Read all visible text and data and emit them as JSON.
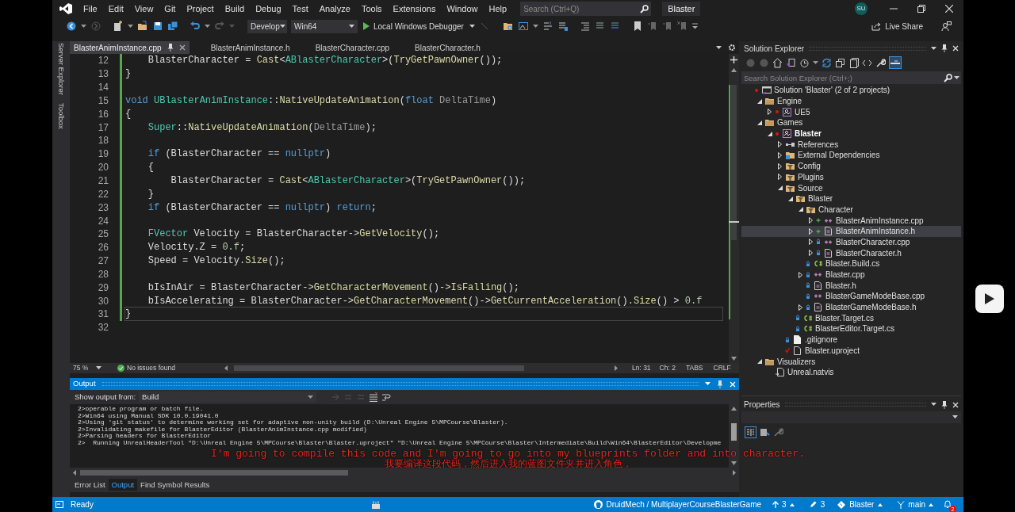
{
  "menu": [
    "File",
    "Edit",
    "View",
    "Git",
    "Project",
    "Build",
    "Debug",
    "Test",
    "Analyze",
    "Tools",
    "Extensions",
    "Window",
    "Help"
  ],
  "search": {
    "placeholder": "Search (Ctrl+Q)"
  },
  "window": {
    "title": "Blaster",
    "user_initials": "SU"
  },
  "toolbar": {
    "configuration": "Develop",
    "platform": "Win64",
    "run_target": "Local Windows Debugger",
    "live_share": "Live Share"
  },
  "side_strip": [
    "Server Explorer",
    "Toolbox"
  ],
  "tabs": [
    {
      "label": "BlasterAnimInstance.cpp",
      "selected": true
    },
    {
      "label": "BlasterAnimInstance.h",
      "selected": false
    },
    {
      "label": "BlasterCharacter.cpp",
      "selected": false
    },
    {
      "label": "BlasterCharacter.h",
      "selected": false
    }
  ],
  "code": [
    {
      "number": "12",
      "current": false,
      "changed": true,
      "tokens": [
        {
          "text": "    BlasterCharacter = ",
          "kind": "plain"
        },
        {
          "text": "Cast",
          "kind": "fn"
        },
        {
          "text": "<",
          "kind": "plain"
        },
        {
          "text": "ABlasterCharacter",
          "kind": "type"
        },
        {
          "text": ">(",
          "kind": "plain"
        },
        {
          "text": "TryGetPawnOwner",
          "kind": "fn"
        },
        {
          "text": "());",
          "kind": "plain"
        }
      ]
    },
    {
      "number": "13",
      "current": false,
      "changed": true,
      "tokens": [
        {
          "text": "}",
          "kind": "plain"
        }
      ]
    },
    {
      "number": "14",
      "current": false,
      "changed": true
    },
    {
      "number": "15",
      "current": false,
      "changed": true,
      "tokens": [
        {
          "text": "void ",
          "kind": "kw"
        },
        {
          "text": "UBlasterAnimInstance",
          "kind": "type"
        },
        {
          "text": "::",
          "kind": "plain"
        },
        {
          "text": "NativeUpdateAnimation",
          "kind": "fn"
        },
        {
          "text": "(",
          "kind": "plain"
        },
        {
          "text": "float ",
          "kind": "kw"
        },
        {
          "text": "DeltaTime",
          "kind": "param"
        },
        {
          "text": ")",
          "kind": "plain"
        }
      ]
    },
    {
      "number": "16",
      "current": false,
      "changed": true,
      "tokens": [
        {
          "text": "{",
          "kind": "plain"
        }
      ]
    },
    {
      "number": "17",
      "current": false,
      "changed": true,
      "tokens": [
        {
          "text": "    Super",
          "kind": "type"
        },
        {
          "text": "::",
          "kind": "plain"
        },
        {
          "text": "NativeUpdateAnimation",
          "kind": "fn"
        },
        {
          "text": "(",
          "kind": "plain"
        },
        {
          "text": "DeltaTime",
          "kind": "param"
        },
        {
          "text": ");",
          "kind": "plain"
        }
      ]
    },
    {
      "number": "18",
      "current": false,
      "changed": true
    },
    {
      "number": "19",
      "current": false,
      "changed": true,
      "tokens": [
        {
          "text": "    if",
          "kind": "kw"
        },
        {
          "text": " (BlasterCharacter == ",
          "kind": "plain"
        },
        {
          "text": "nullptr",
          "kind": "kw"
        },
        {
          "text": ")",
          "kind": "plain"
        }
      ]
    },
    {
      "number": "20",
      "current": false,
      "changed": true,
      "tokens": [
        {
          "text": "    {",
          "kind": "plain"
        }
      ]
    },
    {
      "number": "21",
      "current": false,
      "changed": true,
      "tokens": [
        {
          "text": "        BlasterCharacter = ",
          "kind": "plain"
        },
        {
          "text": "Cast",
          "kind": "fn"
        },
        {
          "text": "<",
          "kind": "plain"
        },
        {
          "text": "ABlasterCharacter",
          "kind": "type"
        },
        {
          "text": ">(",
          "kind": "plain"
        },
        {
          "text": "TryGetPawnOwner",
          "kind": "fn"
        },
        {
          "text": "());",
          "kind": "plain"
        }
      ]
    },
    {
      "number": "22",
      "current": false,
      "changed": true,
      "tokens": [
        {
          "text": "    }",
          "kind": "plain"
        }
      ]
    },
    {
      "number": "23",
      "current": false,
      "changed": true,
      "tokens": [
        {
          "text": "    if",
          "kind": "kw"
        },
        {
          "text": " (BlasterCharacter == ",
          "kind": "plain"
        },
        {
          "text": "nullptr",
          "kind": "kw"
        },
        {
          "text": ") ",
          "kind": "plain"
        },
        {
          "text": "return",
          "kind": "kw"
        },
        {
          "text": ";",
          "kind": "plain"
        }
      ]
    },
    {
      "number": "24",
      "current": false,
      "changed": true
    },
    {
      "number": "25",
      "current": false,
      "changed": true,
      "tokens": [
        {
          "text": "    FVector",
          "kind": "type"
        },
        {
          "text": " Velocity = BlasterCharacter->",
          "kind": "plain"
        },
        {
          "text": "GetVelocity",
          "kind": "fn"
        },
        {
          "text": "();",
          "kind": "plain"
        }
      ]
    },
    {
      "number": "26",
      "current": false,
      "changed": true,
      "tokens": [
        {
          "text": "    Velocity.Z = ",
          "kind": "plain"
        },
        {
          "text": "0.f",
          "kind": "num"
        },
        {
          "text": ";",
          "kind": "plain"
        }
      ]
    },
    {
      "number": "27",
      "current": false,
      "changed": true,
      "tokens": [
        {
          "text": "    Speed = Velocity.",
          "kind": "plain"
        },
        {
          "text": "Size",
          "kind": "fn"
        },
        {
          "text": "();",
          "kind": "plain"
        }
      ]
    },
    {
      "number": "28",
      "current": false,
      "changed": true
    },
    {
      "number": "29",
      "current": false,
      "changed": true,
      "tokens": [
        {
          "text": "    bIsInAir = BlasterCharacter->",
          "kind": "plain"
        },
        {
          "text": "GetCharacterMovement",
          "kind": "fn"
        },
        {
          "text": "()->",
          "kind": "plain"
        },
        {
          "text": "IsFalling",
          "kind": "fn"
        },
        {
          "text": "();",
          "kind": "plain"
        }
      ]
    },
    {
      "number": "30",
      "current": false,
      "changed": true,
      "tokens": [
        {
          "text": "    bIsAccelerating = BlasterCharacter->",
          "kind": "plain"
        },
        {
          "text": "GetCharacterMovement",
          "kind": "fn"
        },
        {
          "text": "()->",
          "kind": "plain"
        },
        {
          "text": "GetCurrentAcceleration",
          "kind": "fn"
        },
        {
          "text": "().",
          "kind": "plain"
        },
        {
          "text": "Size",
          "kind": "fn"
        },
        {
          "text": "() > ",
          "kind": "plain"
        },
        {
          "text": "0.f",
          "kind": "num"
        }
      ]
    },
    {
      "number": "31",
      "current": true,
      "changed": true,
      "tokens": [
        {
          "text": "}",
          "kind": "plain"
        }
      ]
    },
    {
      "number": "32",
      "current": false,
      "changed": false
    }
  ],
  "editor_status": {
    "zoom": "75 %",
    "issues": "No issues found",
    "line": "Ln: 31",
    "column": "Ch: 2",
    "indent": "TABS",
    "line_endings": "CRLF"
  },
  "output": {
    "title": "Output",
    "source_label": "Show output from:",
    "source": "Build",
    "lines": [
      "2>operable program or batch file.",
      "2>Win64 using Manual SDK 10.0.19041.0",
      "2>Using 'git status' to determine working set for adaptive non-unity build (D:\\Unreal Engine 5\\MPCourse\\Blaster).",
      "2>Invalidating makefile for BlasterEditor (BlasterAnimInstance.cpp modified)",
      "2>Parsing headers for BlasterEditor",
      "2>  Running UnrealHeaderTool \"D:\\Unreal Engine 5\\MPCourse\\Blaster\\Blaster.uproject\" \"D:\\Unreal Engine 5\\MPCourse\\Blaster\\Intermediate\\Build\\Win64\\BlasterEditor\\Developme"
    ]
  },
  "bottom_tabs": [
    {
      "label": "Error List",
      "selected": false
    },
    {
      "label": "Output",
      "selected": true
    },
    {
      "label": "Find Symbol Results",
      "selected": false
    }
  ],
  "solution_explorer": {
    "title": "Solution Explorer",
    "search_placeholder": "Search Solution Explorer (Ctrl+;)",
    "tree": [
      {
        "label": "Solution 'Blaster' (2 of 2 projects)",
        "kind": "solution",
        "pending_change": true,
        "selected": false,
        "children": [
          {
            "label": "Engine",
            "kind": "folder",
            "expanded": true,
            "selected": false,
            "children": [
              {
                "label": "UE5",
                "kind": "project",
                "pending_change": true,
                "expanded": false,
                "selected": false
              }
            ]
          },
          {
            "label": "Games",
            "kind": "folder",
            "expanded": true,
            "selected": false,
            "children": [
              {
                "label": "Blaster",
                "kind": "project",
                "pending_change": true,
                "startup": true,
                "expanded": true,
                "selected": false,
                "children": [
                  {
                    "label": "References",
                    "kind": "references",
                    "expanded": false,
                    "selected": false
                  },
                  {
                    "label": "External Dependencies",
                    "kind": "external",
                    "expanded": false,
                    "selected": false
                  },
                  {
                    "label": "Config",
                    "kind": "filter",
                    "expanded": false,
                    "selected": false
                  },
                  {
                    "label": "Plugins",
                    "kind": "filter",
                    "expanded": false,
                    "selected": false
                  },
                  {
                    "label": "Source",
                    "kind": "filter",
                    "expanded": true,
                    "selected": false,
                    "children": [
                      {
                        "label": "Blaster",
                        "kind": "filter",
                        "expanded": true,
                        "selected": false,
                        "children": [
                          {
                            "label": "Character",
                            "kind": "filter",
                            "expanded": true,
                            "selected": false,
                            "children": [
                              {
                                "label": "BlasterAnimInstance.cpp",
                                "kind": "cpp",
                                "added": true,
                                "expanded": false,
                                "selected": false
                              },
                              {
                                "label": "BlasterAnimInstance.h",
                                "kind": "h",
                                "added": true,
                                "expanded": false,
                                "selected": true
                              },
                              {
                                "label": "BlasterCharacter.cpp",
                                "kind": "cpp",
                                "locked": true,
                                "expanded": false,
                                "selected": false
                              },
                              {
                                "label": "BlasterCharacter.h",
                                "kind": "h",
                                "locked": true,
                                "expanded": false,
                                "selected": false
                              }
                            ]
                          },
                          {
                            "label": "Blaster.Build.cs",
                            "kind": "cs",
                            "locked": true,
                            "selected": false
                          },
                          {
                            "label": "Blaster.cpp",
                            "kind": "cpp",
                            "locked": true,
                            "expanded": false,
                            "selected": false
                          },
                          {
                            "label": "Blaster.h",
                            "kind": "h",
                            "locked": true,
                            "selected": false
                          },
                          {
                            "label": "BlasterGameModeBase.cpp",
                            "kind": "cpp",
                            "locked": true,
                            "selected": false
                          },
                          {
                            "label": "BlasterGameModeBase.h",
                            "kind": "h",
                            "locked": true,
                            "expanded": false,
                            "selected": false
                          }
                        ]
                      },
                      {
                        "label": "Blaster.Target.cs",
                        "kind": "cs",
                        "locked": true,
                        "selected": false
                      },
                      {
                        "label": "BlasterEditor.Target.cs",
                        "kind": "cs",
                        "locked": true,
                        "selected": false
                      }
                    ]
                  },
                  {
                    "label": ".gitignore",
                    "kind": "file",
                    "locked": true,
                    "selected": false
                  },
                  {
                    "label": "Blaster.uproject",
                    "kind": "doc",
                    "checked_out": true,
                    "selected": false
                  }
                ]
              }
            ]
          },
          {
            "label": "Visualizers",
            "kind": "folder",
            "expanded": true,
            "selected": false,
            "children": [
              {
                "label": "Unreal.natvis",
                "kind": "natvis",
                "selected": false
              }
            ]
          }
        ]
      }
    ]
  },
  "properties": {
    "title": "Properties"
  },
  "status_bar": {
    "state": "Ready",
    "repository": "DruidMech / MultiplayerCourseBlasterGame",
    "outgoing": "3",
    "changes": "3",
    "project": "Blaster",
    "branch": "main",
    "notifications": "2"
  },
  "subtitles": [
    "I'm going to compile this code and I'm going to go into my blueprints folder and into character.",
    "我要编译这段代码，然后进入我的蓝图文件夹并进入角色，"
  ]
}
